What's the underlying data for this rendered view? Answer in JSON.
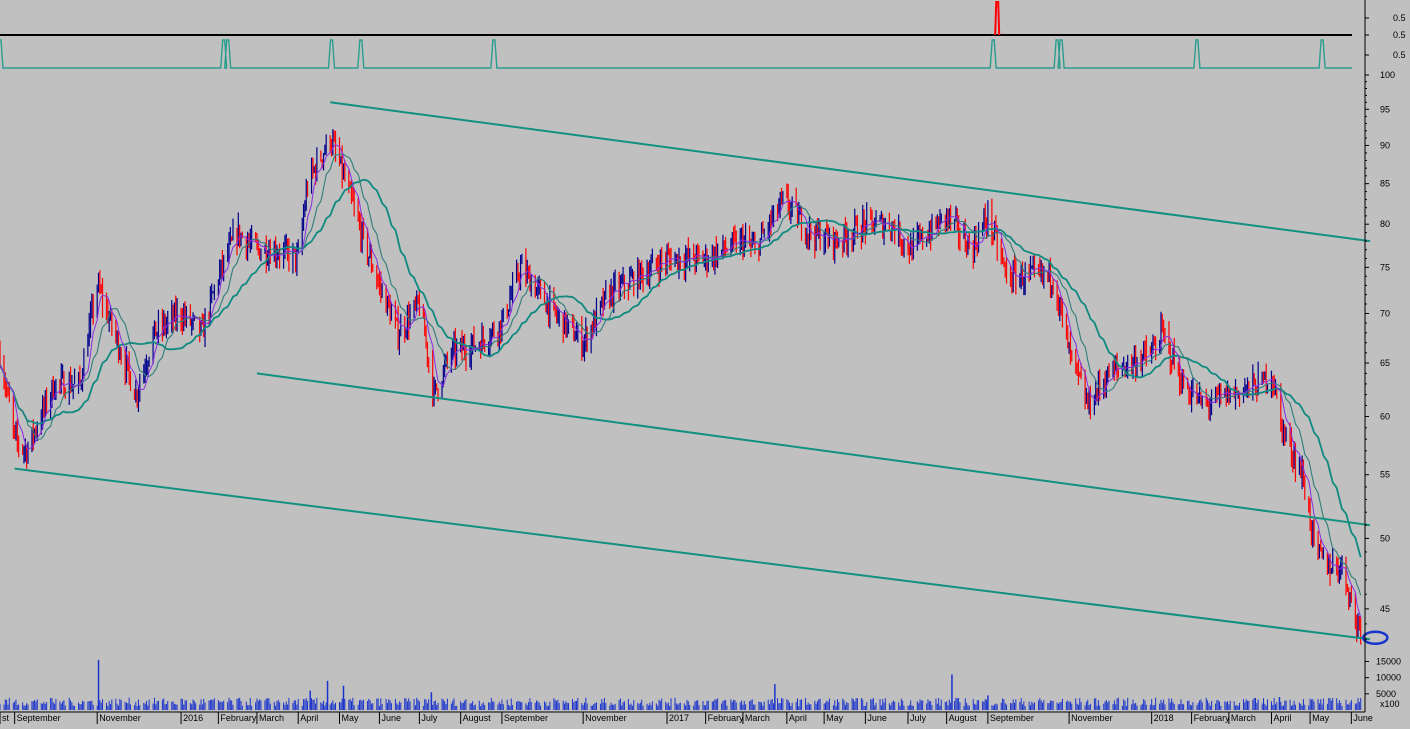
{
  "chart_data": {
    "type": "candlestick",
    "colors": {
      "background": "#c0c0c0",
      "bull": "#00008b",
      "bear": "#ff0000",
      "ma_slow": "#0f8a80",
      "ma_mid": "#2e7d7a",
      "ma_fast": "#8a2be2",
      "channel": "#129080",
      "indicator": "#2a9d8f",
      "marker": "#1a33cc"
    },
    "price_axis": {
      "ticks": [
        45,
        50,
        55,
        60,
        65,
        70,
        75,
        80,
        85,
        90,
        95,
        100
      ],
      "range": [
        42,
        100
      ]
    },
    "volume_axis": {
      "ticks": [
        5000,
        10000,
        15000
      ],
      "range": [
        0,
        17000
      ],
      "scale_label": "x100"
    },
    "indicator_axis": {
      "ticks_top": [
        "0.5",
        "0.5",
        "0.5"
      ]
    },
    "time_axis": {
      "range": [
        "2015-08-21",
        "2018-06-15"
      ],
      "ticks": [
        {
          "label": "st",
          "date": "2015-08-21"
        },
        {
          "label": "September",
          "date": "2015-09-01"
        },
        {
          "label": "November",
          "date": "2015-11-02"
        },
        {
          "label": "2016",
          "date": "2016-01-04"
        },
        {
          "label": "February",
          "date": "2016-02-01"
        },
        {
          "label": "March",
          "date": "2016-03-01"
        },
        {
          "label": "April",
          "date": "2016-04-01"
        },
        {
          "label": "May",
          "date": "2016-05-02"
        },
        {
          "label": "June",
          "date": "2016-06-01"
        },
        {
          "label": "July",
          "date": "2016-07-01"
        },
        {
          "label": "August",
          "date": "2016-08-01"
        },
        {
          "label": "September",
          "date": "2016-09-01"
        },
        {
          "label": "November",
          "date": "2016-11-01"
        },
        {
          "label": "2017",
          "date": "2017-01-03"
        },
        {
          "label": "February",
          "date": "2017-02-01"
        },
        {
          "label": "March",
          "date": "2017-03-01"
        },
        {
          "label": "April",
          "date": "2017-04-03"
        },
        {
          "label": "May",
          "date": "2017-05-01"
        },
        {
          "label": "June",
          "date": "2017-06-01"
        },
        {
          "label": "July",
          "date": "2017-07-03"
        },
        {
          "label": "August",
          "date": "2017-08-01"
        },
        {
          "label": "September",
          "date": "2017-09-01"
        },
        {
          "label": "November",
          "date": "2017-11-01"
        },
        {
          "label": "2018",
          "date": "2018-01-02"
        },
        {
          "label": "February",
          "date": "2018-02-01"
        },
        {
          "label": "March",
          "date": "2018-03-01"
        },
        {
          "label": "April",
          "date": "2018-04-02"
        },
        {
          "label": "May",
          "date": "2018-05-01"
        },
        {
          "label": "June",
          "date": "2018-06-01"
        }
      ]
    },
    "price_path": [
      [
        "2015-08-21",
        66
      ],
      [
        "2015-09-01",
        58
      ],
      [
        "2015-09-10",
        57
      ],
      [
        "2015-10-01",
        63
      ],
      [
        "2015-10-20",
        63
      ],
      [
        "2015-11-02",
        73
      ],
      [
        "2015-11-20",
        66
      ],
      [
        "2015-12-01",
        62
      ],
      [
        "2015-12-15",
        68
      ],
      [
        "2016-01-04",
        70
      ],
      [
        "2016-01-20",
        68
      ],
      [
        "2016-02-01",
        74
      ],
      [
        "2016-02-15",
        79
      ],
      [
        "2016-03-01",
        77
      ],
      [
        "2016-03-15",
        77
      ],
      [
        "2016-04-01",
        76
      ],
      [
        "2016-04-08",
        85
      ],
      [
        "2016-04-25",
        91
      ],
      [
        "2016-05-05",
        86
      ],
      [
        "2016-05-20",
        78
      ],
      [
        "2016-06-01",
        73
      ],
      [
        "2016-06-15",
        68
      ],
      [
        "2016-07-01",
        71
      ],
      [
        "2016-07-12",
        62
      ],
      [
        "2016-07-25",
        66
      ],
      [
        "2016-08-15",
        67
      ],
      [
        "2016-09-01",
        69
      ],
      [
        "2016-09-15",
        75
      ],
      [
        "2016-10-10",
        70
      ],
      [
        "2016-11-01",
        67
      ],
      [
        "2016-11-20",
        72
      ],
      [
        "2017-01-03",
        76
      ],
      [
        "2017-02-01",
        76
      ],
      [
        "2017-03-01",
        78
      ],
      [
        "2017-03-10",
        77
      ],
      [
        "2017-04-01",
        83
      ],
      [
        "2017-04-20",
        79
      ],
      [
        "2017-05-10",
        78
      ],
      [
        "2017-06-01",
        80
      ],
      [
        "2017-06-20",
        80
      ],
      [
        "2017-07-05",
        77
      ],
      [
        "2017-08-01",
        81
      ],
      [
        "2017-08-20",
        77
      ],
      [
        "2017-09-01",
        81
      ],
      [
        "2017-09-15",
        74
      ],
      [
        "2017-10-01",
        74
      ],
      [
        "2017-10-20",
        74
      ],
      [
        "2017-11-01",
        66
      ],
      [
        "2017-11-15",
        61
      ],
      [
        "2017-12-01",
        64
      ],
      [
        "2018-01-02",
        66
      ],
      [
        "2018-01-10",
        68
      ],
      [
        "2018-01-25",
        63
      ],
      [
        "2018-02-10",
        61
      ],
      [
        "2018-03-01",
        62
      ],
      [
        "2018-03-25",
        63
      ],
      [
        "2018-04-02",
        64
      ],
      [
        "2018-04-10",
        59
      ],
      [
        "2018-04-25",
        55
      ],
      [
        "2018-05-05",
        49
      ],
      [
        "2018-05-15",
        48
      ],
      [
        "2018-05-25",
        48
      ],
      [
        "2018-06-05",
        44
      ]
    ],
    "price_range": {
      "start": "2015-08-21",
      "end": "2018-06-08"
    },
    "channel_lines": [
      {
        "from": [
          "2016-04-25",
          96
        ],
        "to": [
          "2018-06-15",
          78
        ]
      },
      {
        "from": [
          "2016-03-01",
          64
        ],
        "to": [
          "2018-06-15",
          51
        ]
      },
      {
        "from": [
          "2015-09-01",
          55.5
        ],
        "to": [
          "2018-06-15",
          43
        ]
      }
    ],
    "annotation_ellipse": {
      "date": "2018-06-10",
      "value": 43.1
    },
    "indicator_spikes": [
      "2015-08-21",
      "2016-02-05",
      "2016-02-08",
      "2016-04-26",
      "2016-05-18",
      "2016-08-26",
      "2017-09-05",
      "2017-10-23",
      "2017-10-26",
      "2018-02-05",
      "2018-05-10"
    ],
    "red_spike_date": "2017-09-08",
    "volume_spikes": [
      [
        "2015-11-03",
        15500
      ],
      [
        "2016-04-23",
        9000
      ],
      [
        "2016-05-05",
        7500
      ],
      [
        "2016-04-10",
        6000
      ],
      [
        "2017-08-05",
        11000
      ],
      [
        "2017-03-25",
        8000
      ],
      [
        "2016-07-10",
        5500
      ],
      [
        "2018-04-08",
        4000
      ],
      [
        "2017-09-01",
        4500
      ]
    ]
  }
}
